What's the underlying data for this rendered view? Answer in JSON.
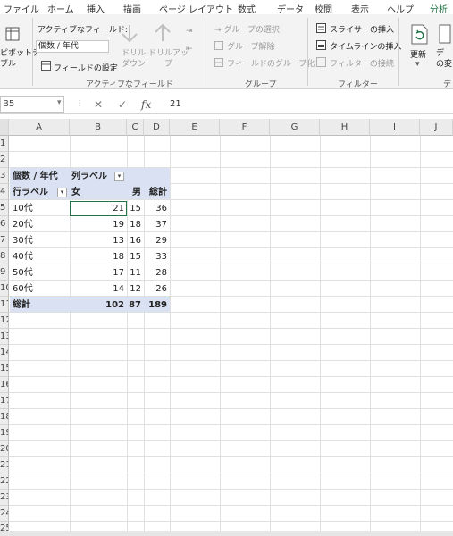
{
  "ribbon_tabs": [
    "ファイル",
    "ホーム",
    "挿入",
    "描画",
    "ページ レイアウト",
    "数式",
    "データ",
    "校閲",
    "表示",
    "ヘルプ",
    "分析"
  ],
  "active_tab": "分析",
  "ribbon": {
    "pivot_table_label": "ピボットテー\nブル",
    "active_field_label": "アクティブなフィールド:",
    "active_field_value": "個数 / 年代",
    "field_settings": "フィールドの設定",
    "drill_down": "ドリル\nダウン",
    "drill_up": "ドリルアッ\nプ",
    "active_field_group": "アクティブなフィールド",
    "group_selection": "→ グループの選択",
    "ungroup": "グループ解除",
    "group_field": "フィールドのグループ化",
    "group_group": "グループ",
    "insert_slicer": "スライサーの挿入",
    "insert_timeline": "タイムラインの挿入",
    "filter_connections": "フィルターの接続",
    "filter_group": "フィルター",
    "refresh": "更新",
    "data_source": "デ\nの変",
    "data_group": "デ"
  },
  "formula_bar": {
    "name_box": "B5",
    "value": "21",
    "fx": "fx"
  },
  "columns": [
    "A",
    "B",
    "C",
    "D",
    "E",
    "F",
    "G",
    "H",
    "I",
    "J"
  ],
  "rows": [
    "1",
    "2",
    "3",
    "4",
    "5",
    "6",
    "7",
    "8",
    "9",
    "10",
    "11",
    "12",
    "13",
    "14",
    "15",
    "16",
    "17",
    "18",
    "19",
    "20",
    "21",
    "22",
    "23",
    "24",
    "25"
  ],
  "pivot": {
    "corner_label": "個数 / 年代",
    "col_labels": "列ラベル",
    "row_labels": "行ラベル",
    "female": "女",
    "male": "男",
    "total_header": "総計",
    "rows": [
      {
        "label": "10代",
        "female": "21",
        "male": "15",
        "total": "36"
      },
      {
        "label": "20代",
        "female": "19",
        "male": "18",
        "total": "37"
      },
      {
        "label": "30代",
        "female": "13",
        "male": "16",
        "total": "29"
      },
      {
        "label": "40代",
        "female": "18",
        "male": "15",
        "total": "33"
      },
      {
        "label": "50代",
        "female": "17",
        "male": "11",
        "total": "28"
      },
      {
        "label": "60代",
        "female": "14",
        "male": "12",
        "total": "26"
      }
    ],
    "grand_total_label": "総計",
    "grand_female": "102",
    "grand_male": "87",
    "grand_total": "189"
  },
  "colors": {
    "accent": "#217346",
    "pivot_header": "#d9e1f2"
  }
}
